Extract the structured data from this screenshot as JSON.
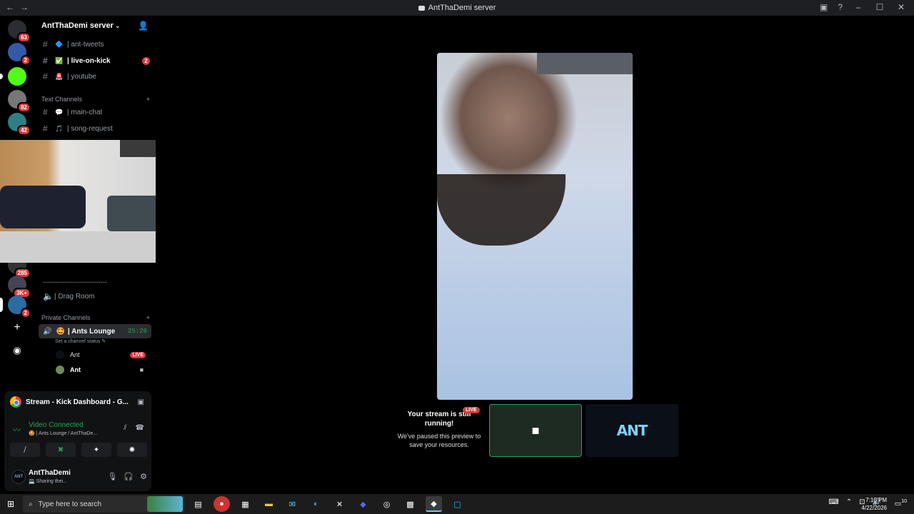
{
  "window": {
    "title": "AntThaDemi server",
    "back_icon": "arrow-left",
    "forward_icon": "arrow-right",
    "controls": [
      "screen-share-icon",
      "help-icon",
      "minimize",
      "maximize",
      "close"
    ]
  },
  "servers": [
    {
      "name": "discord-home",
      "badge": "63"
    },
    {
      "name": "server-blue-waves",
      "badge": "2"
    },
    {
      "name": "server-kick",
      "badge": ""
    },
    {
      "name": "server-avatar-1",
      "badge": "82"
    },
    {
      "name": "server-avatar-2",
      "badge": "42"
    },
    {
      "name": "server-hidden-1",
      "badge": "285"
    },
    {
      "name": "server-hidden-2",
      "badge": "3K+"
    },
    {
      "name": "server-ant",
      "badge": "2"
    },
    {
      "name": "add-server",
      "badge": ""
    },
    {
      "name": "discover",
      "badge": ""
    }
  ],
  "server_header": {
    "name": "AntThaDemi server",
    "chevron": "⌄"
  },
  "channels": [
    {
      "emoji": "🔷",
      "name": "| ant-tweets",
      "active": false,
      "count": ""
    },
    {
      "emoji": "✅",
      "name": "| live-on-kick",
      "active": true,
      "count": "2"
    },
    {
      "emoji": "🚨",
      "name": "| youtube",
      "active": false,
      "count": ""
    }
  ],
  "text_category": "Text Channels",
  "text_channels": [
    {
      "emoji": "💬",
      "name": "| main-chat"
    },
    {
      "emoji": "🎵",
      "name": "| song-request"
    }
  ],
  "divider_label": "------------------------------",
  "drag_room": "| Drag Room",
  "private_category": "Private Channels",
  "voice_channel": {
    "emoji": "🤩",
    "name": "| Ants Lounge",
    "timer": "25:26",
    "status_placeholder": "Set a channel status"
  },
  "members": [
    {
      "name": "Ant",
      "live": "LIVE"
    },
    {
      "name": "Ant",
      "live": ""
    }
  ],
  "voice_panel": {
    "activity": "Stream - Kick Dashboard - G...",
    "connection": "Video Connected",
    "location": "🤩 | Ants Lounge / AntThaDe...",
    "buttons": [
      "camera-off",
      "screen-share",
      "activities",
      "soundboard"
    ]
  },
  "user_panel": {
    "name": "AntThaDemi",
    "status": "💻 Sharing thei...",
    "avatar_text": "ANT"
  },
  "stage": {
    "preview_title": "Your stream is still running!",
    "preview_sub": "We've paused this preview to save your resources.",
    "live": "LIVE",
    "tile2_text": "ANT"
  },
  "taskbar": {
    "search_placeholder": "Type here to search",
    "time": "7:10 PM",
    "date": "4/22/2026",
    "notif_count": "10"
  }
}
